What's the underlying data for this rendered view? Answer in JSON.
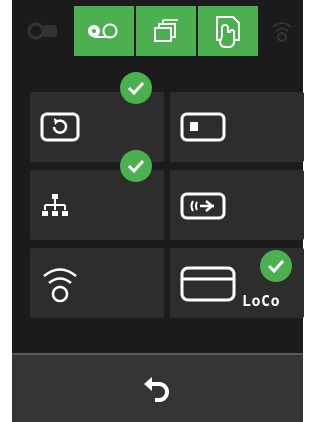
{
  "colors": {
    "background": "#1b1b1b",
    "tile": "#2d2d2d",
    "accent": "#4caf50",
    "icon": "#ffffff",
    "icon_dim": "#333333",
    "bottom_bar": "#353535"
  },
  "top_bar": {
    "icons": [
      {
        "name": "badge-icon",
        "active": false
      },
      {
        "name": "reel-toggle-icon",
        "active": true
      },
      {
        "name": "stacked-windows-icon",
        "active": true
      },
      {
        "name": "touch-document-icon",
        "active": true
      },
      {
        "name": "wifi-icon",
        "active": false
      }
    ]
  },
  "tiles": [
    {
      "name": "sync-tile",
      "icon": "refresh-card-icon",
      "checked": true
    },
    {
      "name": "card-tile",
      "icon": "card-square-icon",
      "checked": false
    },
    {
      "name": "network-tile",
      "icon": "network-tree-icon",
      "checked": true
    },
    {
      "name": "nfc-tile",
      "icon": "nfc-arrow-icon",
      "checked": false
    },
    {
      "name": "wifi-tile",
      "icon": "wifi-icon",
      "checked": false
    },
    {
      "name": "loco-tile",
      "icon": "credit-card-icon",
      "checked": true,
      "label": "LoCo"
    }
  ],
  "bottom_bar": {
    "back_icon": "back-arrow-icon"
  }
}
